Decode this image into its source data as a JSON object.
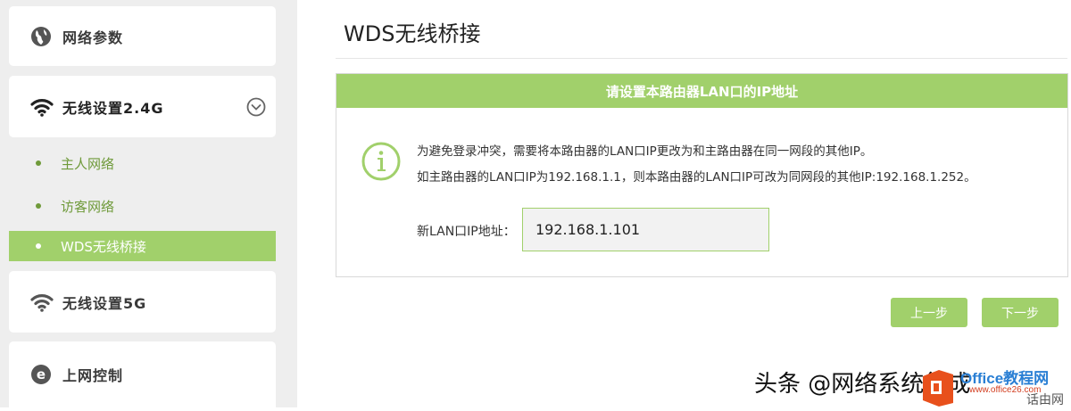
{
  "sidebar": {
    "cards": [
      {
        "label": "网络参数",
        "icon": "globe-icon"
      },
      {
        "label": "无线设置2.4G",
        "icon": "wifi-icon",
        "toggle_icon": "chevron-down-circle-icon"
      },
      {
        "label": "无线设置5G",
        "icon": "wifi-icon"
      },
      {
        "label": "上网控制",
        "icon": "ie-browser-icon"
      }
    ],
    "sub_items": [
      {
        "label": "主人网络"
      },
      {
        "label": "访客网络"
      },
      {
        "label": "WDS无线桥接",
        "active": true
      }
    ]
  },
  "main": {
    "title": "WDS无线桥接",
    "panel": {
      "header": "请设置本路由器LAN口的IP地址",
      "info_icon": "info-circle-icon",
      "info_line_1": "为避免登录冲突，需要将本路由器的LAN口IP更改为和主路由器在同一网段的其他IP。",
      "info_line_2": "如主路由器的LAN口IP为192.168.1.1，则本路由器的LAN口IP可改为同网段的其他IP:192.168.1.252。",
      "field_label": "新LAN口IP地址：",
      "ip_value": "192.168.1.101"
    },
    "buttons": {
      "prev": "上一步",
      "next": "下一步"
    }
  },
  "watermark": {
    "text": "头条 @网络系统集成",
    "site": "Office教程网",
    "url": "www.office26.com",
    "corner": "话由网"
  },
  "colors": {
    "accent": "#a1d06b",
    "sub_text": "#6f9a3a",
    "sidebar_bg": "#eeeeee"
  }
}
